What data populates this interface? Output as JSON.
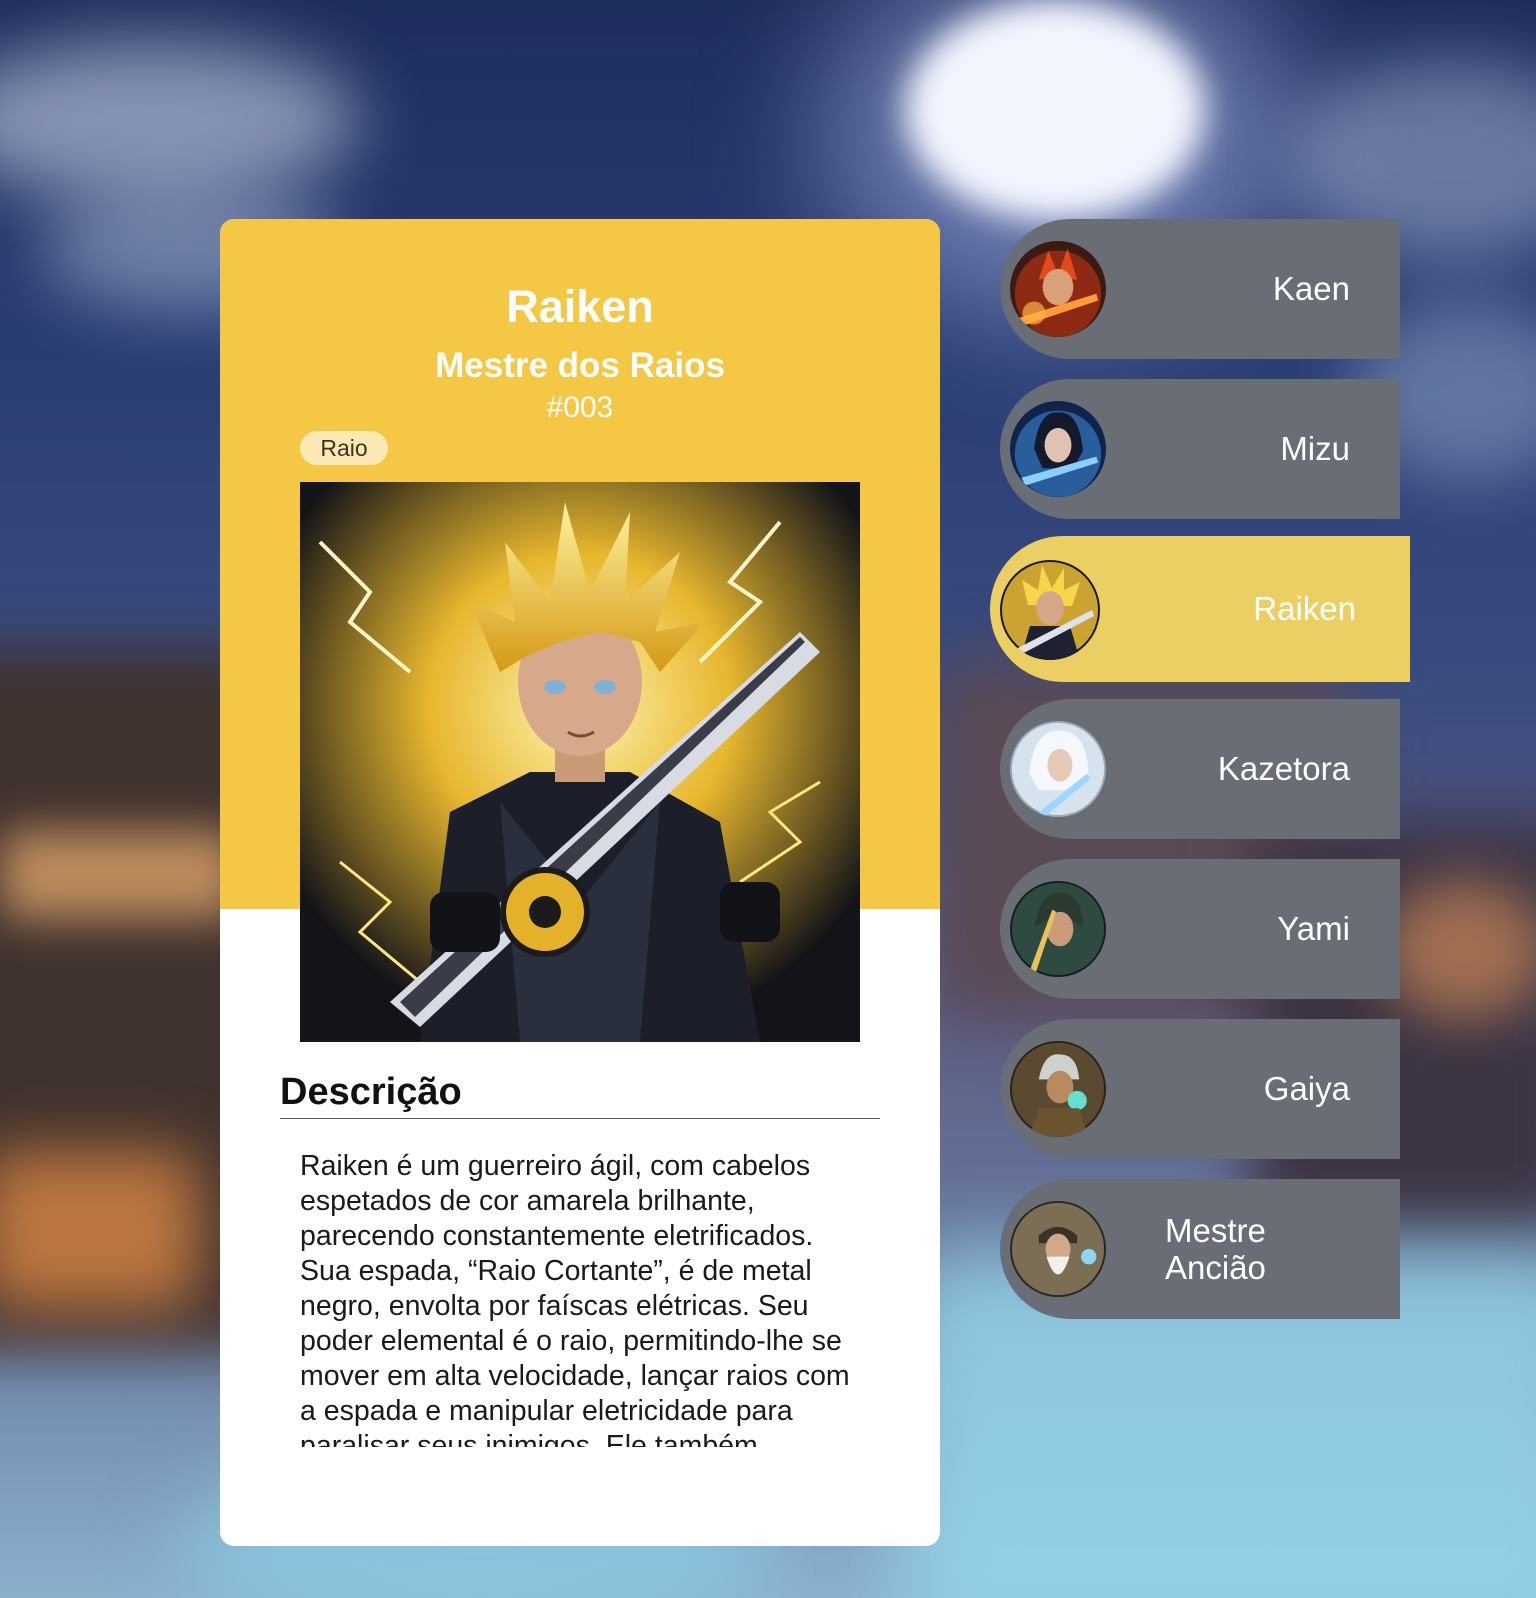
{
  "card": {
    "name": "Raiken",
    "title": "Mestre dos Raios",
    "number": "#003",
    "element": "Raio",
    "description_heading": "Descrição",
    "description": "Raiken é um guerreiro ágil, com cabelos espetados de cor amarela brilhante, parecendo constantemente eletrificados. Sua espada, “Raio Cortante”, é de metal negro, envolta por faíscas elétricas. Seu poder elemental é o raio, permitindo-lhe se mover em alta velocidade, lançar raios com a espada e manipular eletricidade para paralisar seus inimigos. Ele também"
  },
  "characters": [
    {
      "name": "Kaen",
      "active": false,
      "color": "#c0391b"
    },
    {
      "name": "Mizu",
      "active": false,
      "color": "#2f6fb5"
    },
    {
      "name": "Raiken",
      "active": true,
      "color": "#e0b21d"
    },
    {
      "name": "Kazetora",
      "active": false,
      "color": "#bcd4e8"
    },
    {
      "name": "Yami",
      "active": false,
      "color": "#2f5a4a"
    },
    {
      "name": "Gaiya",
      "active": false,
      "color": "#3e7f6a"
    },
    {
      "name": "Mestre Ancião",
      "active": false,
      "color": "#8a7a5a"
    }
  ],
  "theme": {
    "card_header": "#f4c745",
    "badge_bg": "#fbe9b5",
    "selector_bg": "#686d76",
    "selector_active_bg": "#eccf62"
  }
}
